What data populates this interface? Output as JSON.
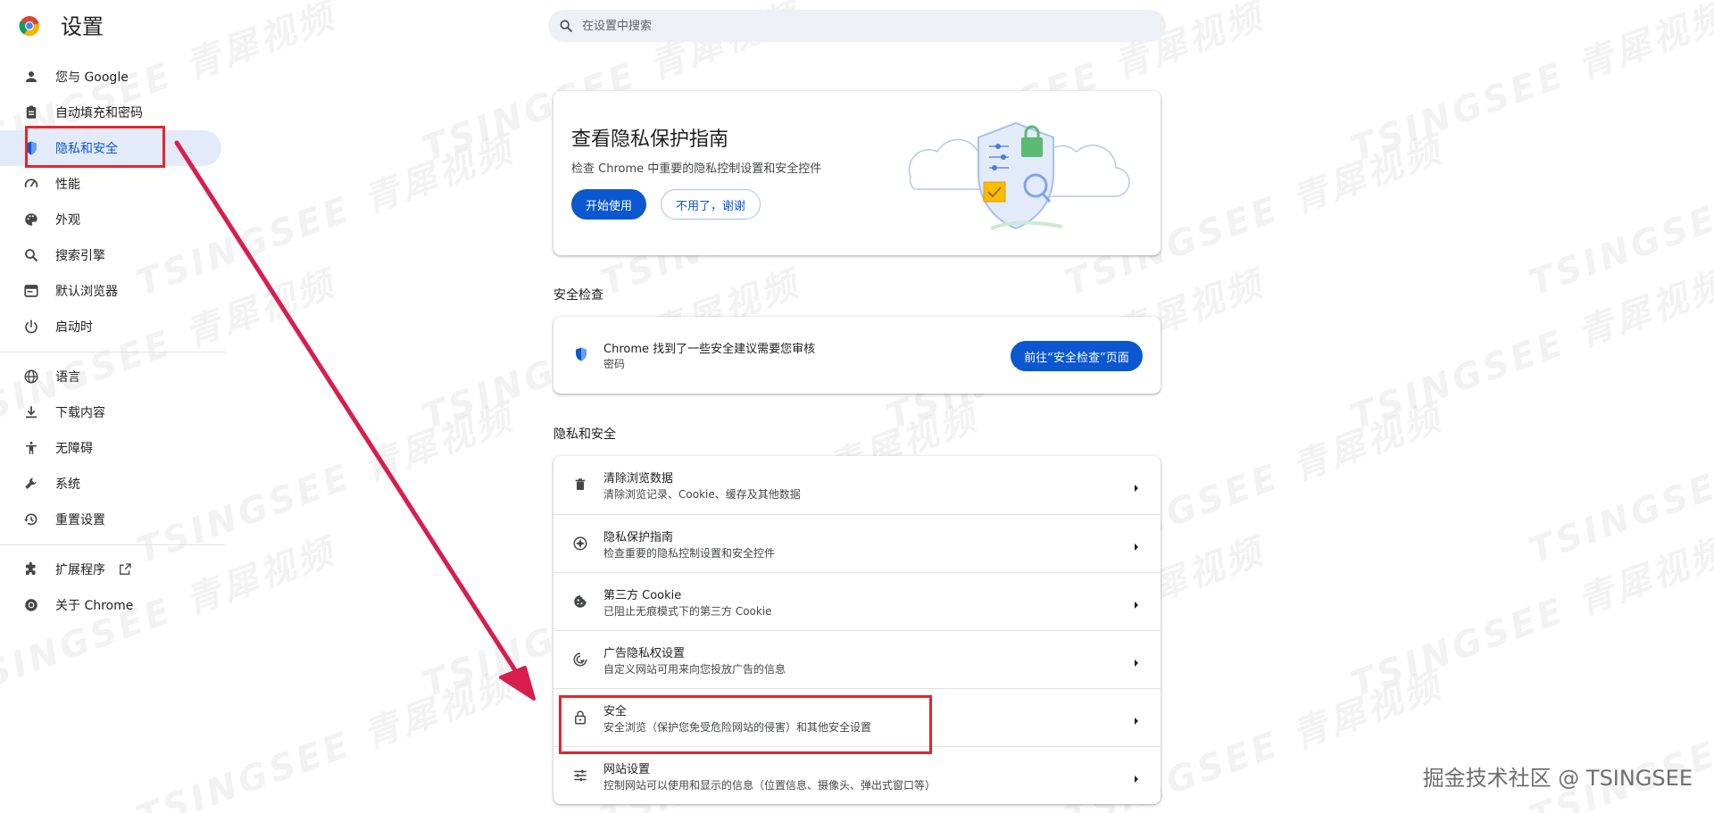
{
  "header": {
    "title": "设置",
    "search_placeholder": "在设置中搜索"
  },
  "sidebar": {
    "items": [
      {
        "label": "您与 Google",
        "icon": "person-icon"
      },
      {
        "label": "自动填充和密码",
        "icon": "clipboard-icon"
      },
      {
        "label": "隐私和安全",
        "icon": "shield-icon",
        "active": true
      },
      {
        "label": "性能",
        "icon": "gauge-icon"
      },
      {
        "label": "外观",
        "icon": "palette-icon"
      },
      {
        "label": "搜索引擎",
        "icon": "search-icon"
      },
      {
        "label": "默认浏览器",
        "icon": "browser-icon"
      },
      {
        "label": "启动时",
        "icon": "power-icon"
      },
      {
        "label": "语言",
        "icon": "globe-icon"
      },
      {
        "label": "下载内容",
        "icon": "download-icon"
      },
      {
        "label": "无障碍",
        "icon": "accessibility-icon"
      },
      {
        "label": "系统",
        "icon": "wrench-icon"
      },
      {
        "label": "重置设置",
        "icon": "history-icon"
      },
      {
        "label": "扩展程序",
        "icon": "puzzle-icon"
      },
      {
        "label": "关于 Chrome",
        "icon": "chrome-icon"
      }
    ]
  },
  "guide": {
    "title": "查看隐私保护指南",
    "description": "检查 Chrome 中重要的隐私控制设置和安全控件",
    "start_label": "开始使用",
    "decline_label": "不用了，谢谢"
  },
  "safety_check": {
    "section_title": "安全检查",
    "message": "Chrome 找到了一些安全建议需要您审核",
    "detail": "密码",
    "button_label": "前往“安全检查”页面"
  },
  "privacy": {
    "section_title": "隐私和安全",
    "rows": [
      {
        "title": "清除浏览数据",
        "subtitle": "清除浏览记录、Cookie、缓存及其他数据",
        "icon": "trash-icon"
      },
      {
        "title": "隐私保护指南",
        "subtitle": "检查重要的隐私控制设置和安全控件",
        "icon": "compass-icon"
      },
      {
        "title": "第三方 Cookie",
        "subtitle": "已阻止无痕模式下的第三方 Cookie",
        "icon": "cookie-icon"
      },
      {
        "title": "广告隐私权设置",
        "subtitle": "自定义网站可用来向您投放广告的信息",
        "icon": "ad-privacy-icon"
      },
      {
        "title": "安全",
        "subtitle": "安全浏览（保护您免受危险网站的侵害）和其他安全设置",
        "icon": "lock-icon"
      },
      {
        "title": "网站设置",
        "subtitle": "控制网站可以使用和显示的信息（位置信息、摄像头、弹出式窗口等）",
        "icon": "tune-icon"
      }
    ]
  },
  "watermark": {
    "text": "TSINGSEE 青犀视频",
    "credit": "掘金技术社区 @ TSINGSEE"
  },
  "colors": {
    "accent": "#0b57d0",
    "active_bg": "#e3ebfb",
    "annotation_red": "#e3262d",
    "arrow": "#d81e4f"
  }
}
